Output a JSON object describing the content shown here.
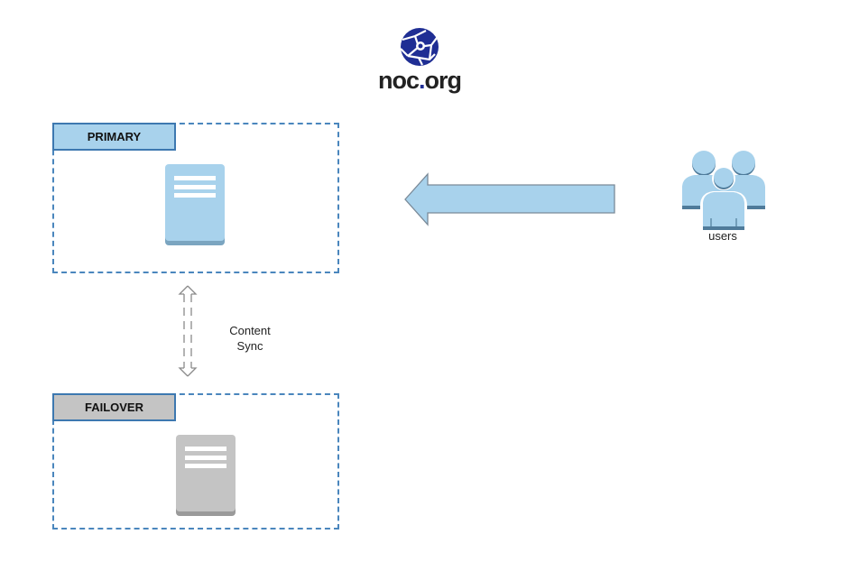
{
  "logo": {
    "name": "noc-globe-icon",
    "text_main": "noc",
    "text_dot": ".",
    "text_tld": "org",
    "color": "#1f2e94"
  },
  "zones": [
    {
      "id": "primary",
      "label": "PRIMARY",
      "label_bg": "#a8d2ec",
      "server_color": "#a8d2ec",
      "server_base": "#7ba5c0"
    },
    {
      "id": "failover",
      "label": "FAILOVER",
      "label_bg": "#c4c4c4",
      "server_color": "#c4c4c4",
      "server_base": "#9a9a9a"
    }
  ],
  "sync": {
    "label_line1": "Content",
    "label_line2": "Sync"
  },
  "traffic_arrow": {
    "direction": "left",
    "fill": "#a8d2ec",
    "stroke": "#7a8a98"
  },
  "users": {
    "label": "users",
    "fill": "#a8d2ec",
    "shade": "#4f7b9a"
  },
  "colors": {
    "zone_border": "#4a86bd",
    "sync_arrow": "#8a8a8a"
  }
}
